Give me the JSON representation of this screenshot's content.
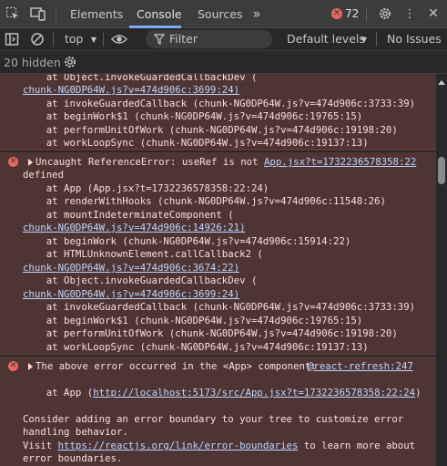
{
  "topbar": {
    "tabs": [
      {
        "label": "Elements"
      },
      {
        "label": "Console"
      },
      {
        "label": "Sources"
      }
    ],
    "error_count": "72"
  },
  "toolbar": {
    "context": "top",
    "filter_placeholder": "Filter",
    "levels": "Default levels",
    "issues": "No Issues"
  },
  "hidden_count": "20 hidden",
  "colors": {
    "accent": "#7cacf8",
    "error_bg": "#4e3534",
    "error_text": "#f9dedc",
    "error_icon": "#e46962",
    "link": "#bfd6ff"
  },
  "msg1": {
    "lines": [
      "    at Object.invokeGuardedCallbackDev (",
      "chunk-NG0DP64W.js?v=474d906c:3699:24)",
      "    at invokeGuardedCallback (chunk-NG0DP64W.js?v=474d906c:3733:39)",
      "    at beginWork$1 (chunk-NG0DP64W.js?v=474d906c:19765:15)",
      "    at performUnitOfWork (chunk-NG0DP64W.js?v=474d906c:19198:20)",
      "    at workLoopSync (chunk-NG0DP64W.js?v=474d906c:19137:13)"
    ]
  },
  "msg2": {
    "source": "App.jsx?t=1732236578358:22",
    "lines": [
      "Uncaught ReferenceError: useRef is not",
      "defined",
      "    at App (App.jsx?t=1732236578358:22:24)",
      "    at renderWithHooks (chunk-NG0DP64W.js?v=474d906c:11548:26)",
      "    at mountIndeterminateComponent (",
      "chunk-NG0DP64W.js?v=474d906c:14926:21)",
      "    at beginWork (chunk-NG0DP64W.js?v=474d906c:15914:22)",
      "    at HTMLUnknownElement.callCallback2 (",
      "chunk-NG0DP64W.js?v=474d906c:3674:22)",
      "    at Object.invokeGuardedCallbackDev (",
      "chunk-NG0DP64W.js?v=474d906c:3699:24)",
      "    at invokeGuardedCallback (chunk-NG0DP64W.js?v=474d906c:3733:39)",
      "    at beginWork$1 (chunk-NG0DP64W.js?v=474d906c:19765:15)",
      "    at performUnitOfWork (chunk-NG0DP64W.js?v=474d906c:19198:20)",
      "    at workLoopSync (chunk-NG0DP64W.js?v=474d906c:19137:13)"
    ]
  },
  "msg3": {
    "source": "@react-refresh:247",
    "header": "The above error occurred in the <App> component:",
    "at_prefix": "    at App (",
    "at_link": "http://localhost:5173/src/App.jsx?t=1732236578358:22:24",
    "at_suffix": ")",
    "advice1": "Consider adding an error boundary to your tree to customize error",
    "advice2": "handling behavior.",
    "visit_prefix": "Visit ",
    "visit_link": "https://reactjs.org/link/error-boundaries",
    "visit_suffix": " to learn more about",
    "advice3": "error boundaries."
  }
}
